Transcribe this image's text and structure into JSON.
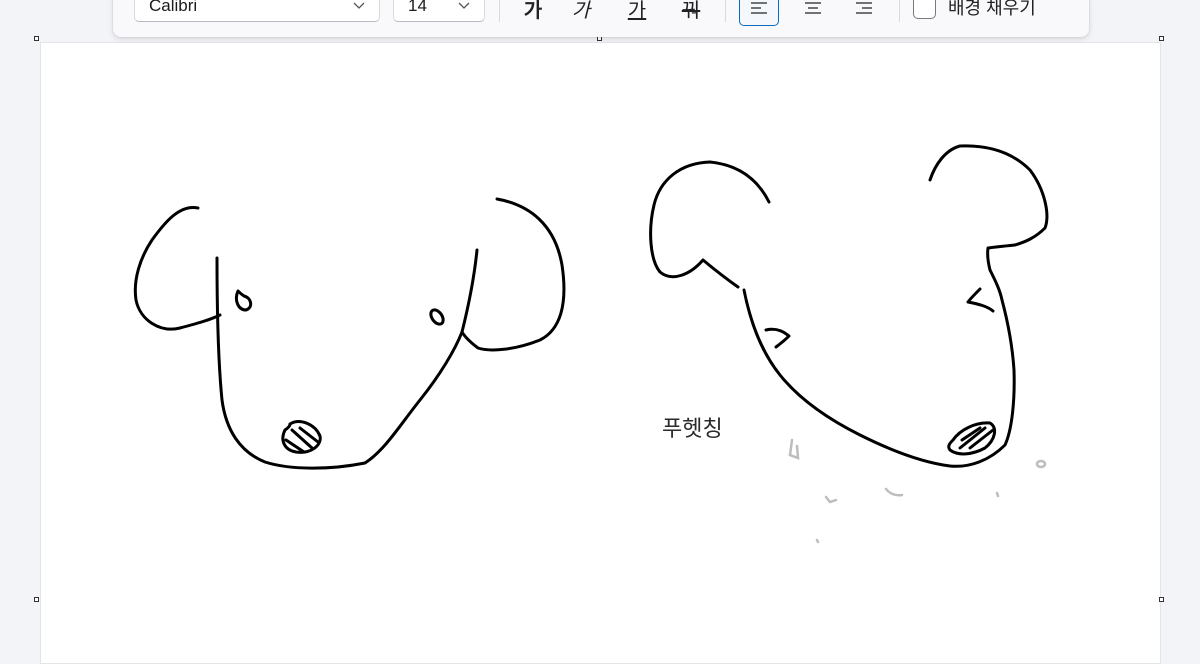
{
  "toolbar": {
    "font_family": "Calibri",
    "font_size": "14",
    "bold_label": "가",
    "italic_label": "가",
    "underline_label": "가",
    "strike_label": "꿔",
    "align_active": "left",
    "fill_background_label": "배경 채우기",
    "fill_background_checked": false
  },
  "canvas": {
    "text_box": "푸헷칭"
  },
  "colors": {
    "accent": "#0f6cbd",
    "canvas": "#ffffff",
    "background": "#f3f4f8",
    "stroke": "#000000"
  }
}
